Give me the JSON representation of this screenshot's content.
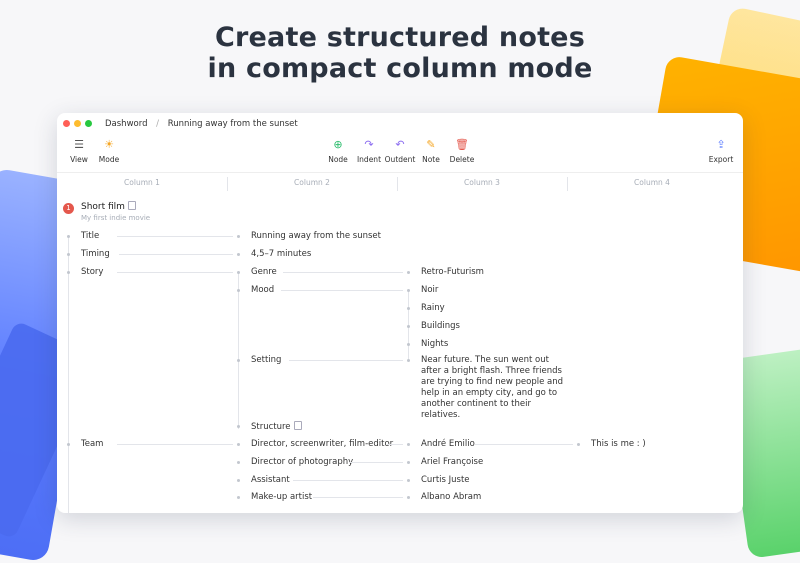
{
  "headline": {
    "line1": "Create structured notes",
    "line2": "in compact column mode"
  },
  "colors": {
    "accent_red": "#e4574c",
    "window_dot_red": "#ff5f57",
    "window_dot_yellow": "#febc2e",
    "window_dot_green": "#28c840"
  },
  "breadcrumb": {
    "home": "Dashword",
    "sep": "/",
    "current": "Running away from the sunset"
  },
  "toolbar": {
    "view": "View",
    "mode": "Mode",
    "node": "Node",
    "indent": "Indent",
    "outdent": "Outdent",
    "note": "Note",
    "delete": "Delete",
    "export": "Export"
  },
  "columns": [
    "Column 1",
    "Column 2",
    "Column 3",
    "Column 4"
  ],
  "root": {
    "badge": "1",
    "title": "Short film",
    "subtitle": "My first indie movie"
  },
  "col1": {
    "title": "Title",
    "timing": "Timing",
    "story": "Story",
    "team": "Team"
  },
  "col2": {
    "title_value": "Running away from the sunset",
    "timing_value": "4,5–7 minutes",
    "genre": "Genre",
    "mood": "Mood",
    "setting": "Setting",
    "structure": "Structure",
    "director": "Director, screenwriter, film-editor",
    "dop": "Director of photography",
    "assistant": "Assistant",
    "makeup": "Make-up artist"
  },
  "col3": {
    "genre_value": "Retro-Futurism",
    "mood_noir": "Noir",
    "mood_rainy": "Rainy",
    "mood_buildings": "Buildings",
    "mood_nights": "Nights",
    "setting_value": "Near future. The sun went out after a bright flash. Three friends are trying to find new people and help in an empty city, and go to another continent to their relatives.",
    "director_name": "André Emilio",
    "dop_name": "Ariel Françoise",
    "assistant_name": "Curtis Juste",
    "makeup_name": "Albano Abram"
  },
  "col4": {
    "director_note": "This is me : )"
  }
}
